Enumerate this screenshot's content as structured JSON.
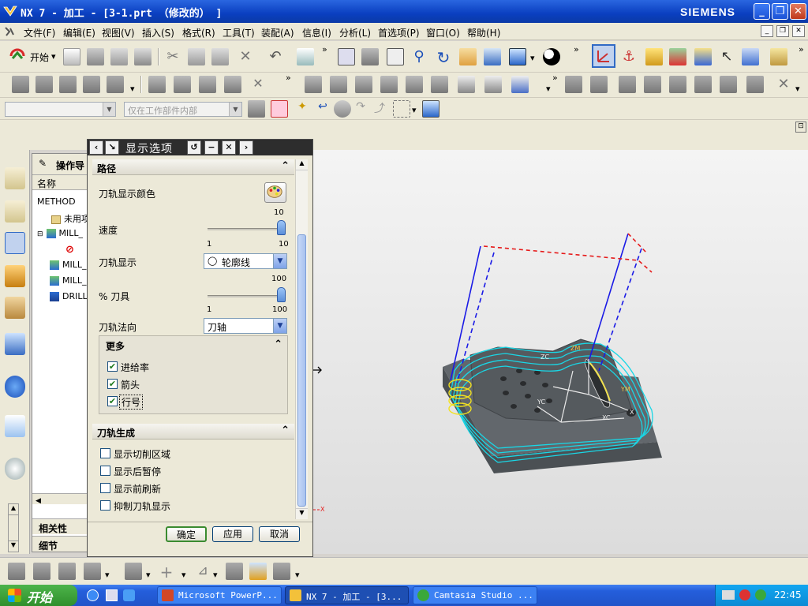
{
  "window": {
    "title": "NX 7 - 加工 - [3-1.prt （修改的） ]",
    "brand": "SIEMENS"
  },
  "menu": [
    "文件(F)",
    "编辑(E)",
    "视图(V)",
    "插入(S)",
    "格式(R)",
    "工具(T)",
    "装配(A)",
    "信息(I)",
    "分析(L)",
    "首选项(P)",
    "窗口(O)",
    "帮助(H)"
  ],
  "toolbar": {
    "start_label": "开始"
  },
  "selection_bar": {
    "filter_placeholder": "",
    "scope_value": "仅在工作部件内部"
  },
  "navigator": {
    "title": "操作导",
    "column_header": "名称",
    "rows": [
      "METHOD",
      "未用项",
      "MILL_",
      "",
      "MILL_",
      "MILL_",
      "DRILL"
    ],
    "bottom_1": "相关性",
    "bottom_2": "细节"
  },
  "dialog": {
    "title": "显示选项",
    "path_group": "路径",
    "toolpath_color_label": "刀轨显示颜色",
    "speed_label": "速度",
    "speed_max": "10",
    "speed_min": "1",
    "speed_max2": "10",
    "speed_value": 10,
    "display_label": "刀轨显示",
    "display_value": "轮廓线",
    "tool_pct_label": "% 刀具",
    "tool_max": "100",
    "tool_min": "1",
    "tool_max2": "100",
    "tool_value": 100,
    "normal_label": "刀轨法向",
    "normal_value": "刀轴",
    "more_group": "更多",
    "more_options": [
      {
        "label": "进给率",
        "checked": true
      },
      {
        "label": "箭头",
        "checked": true
      },
      {
        "label": "行号",
        "checked": true
      }
    ],
    "gen_group": "刀轨生成",
    "gen_options": [
      {
        "label": "显示切削区域",
        "checked": false
      },
      {
        "label": "显示后暂停",
        "checked": false
      },
      {
        "label": "显示前刷新",
        "checked": false
      },
      {
        "label": "抑制刀轨显示",
        "checked": false
      }
    ],
    "ok": "确定",
    "apply": "应用",
    "cancel": "取消"
  },
  "viewport": {
    "axis_labels": [
      "ZM",
      "YM",
      "XC",
      "X",
      "YC",
      "ZC",
      "X"
    ]
  },
  "taskbar": {
    "start": "开始",
    "tasks": [
      "Microsoft PowerP...",
      "NX 7 - 加工 - [3...",
      "Camtasia Studio ..."
    ],
    "clock": "22:45"
  },
  "colors": {
    "toolpath_cyan": "#19d7e6",
    "toolpath_blue": "#1a1ae6",
    "rapid_red": "#e61a1a",
    "part_gray": "#5a5f63",
    "xp_blue": "#245edb"
  }
}
